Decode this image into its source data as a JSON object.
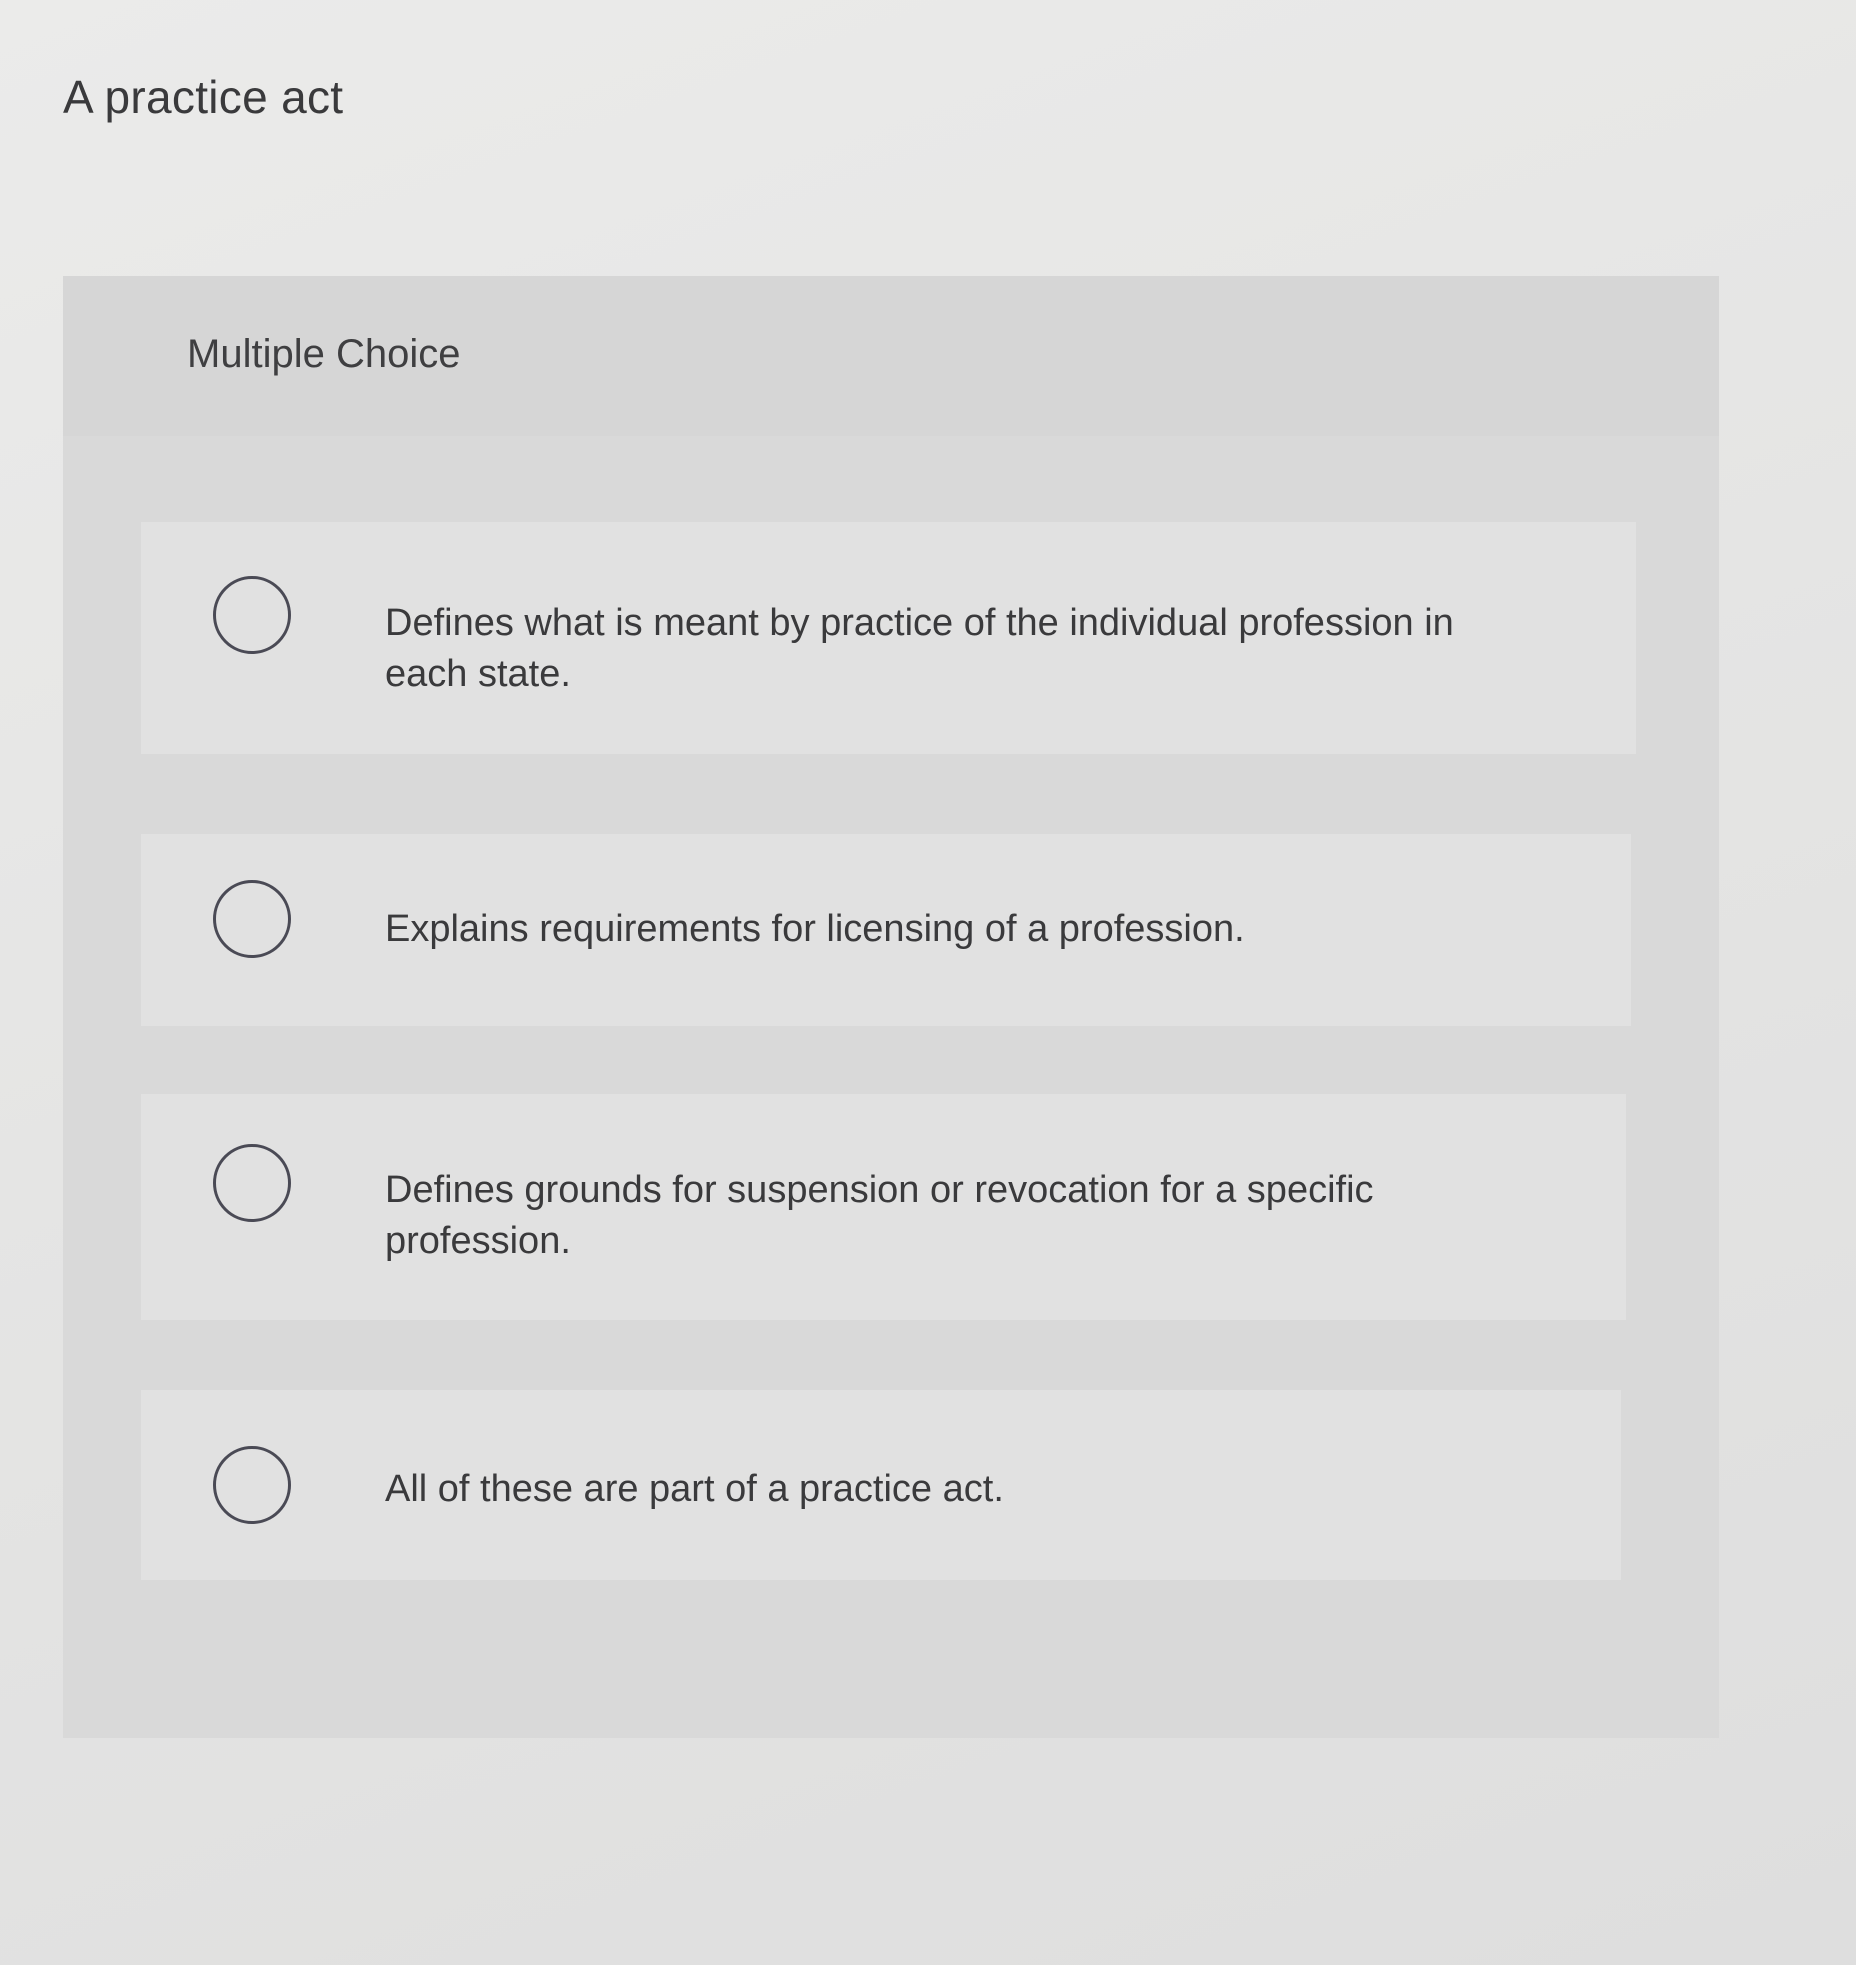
{
  "question": {
    "title": "A practice act"
  },
  "panel": {
    "label": "Multiple Choice"
  },
  "options": [
    {
      "text": "Defines what is meant by practice of the individual profession in each state.",
      "selected": false
    },
    {
      "text": "Explains requirements for licensing of a profession.",
      "selected": false
    },
    {
      "text": "Defines grounds for suspension or revocation for a specific profession.",
      "selected": false
    },
    {
      "text": "All of these are part of a practice act.",
      "selected": false
    }
  ]
}
